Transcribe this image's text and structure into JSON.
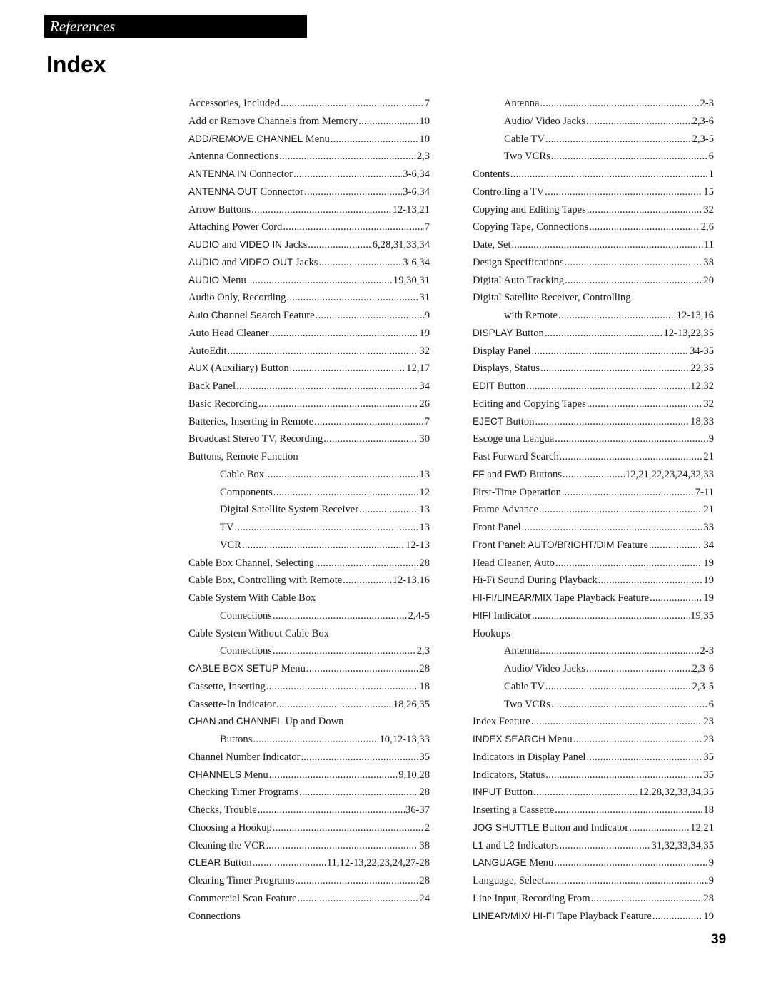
{
  "header": {
    "section": "References",
    "title": "Index"
  },
  "page_number": "39",
  "left_column": [
    {
      "parts": [
        "Accessories, Included"
      ],
      "pages": "7"
    },
    {
      "parts": [
        "Add or Remove Channels from Memory"
      ],
      "pages": "10"
    },
    {
      "parts": [
        {
          "s": "ADD/REMOVE CHANNEL"
        },
        " Menu"
      ],
      "pages": "10"
    },
    {
      "parts": [
        "Antenna Connections"
      ],
      "pages": "2,3"
    },
    {
      "parts": [
        {
          "s": "ANTENNA IN"
        },
        " Connector"
      ],
      "pages": "3-6,34"
    },
    {
      "parts": [
        {
          "s": "ANTENNA OUT"
        },
        " Connector"
      ],
      "pages": "3-6,34"
    },
    {
      "parts": [
        "Arrow Buttons"
      ],
      "pages": "12-13,21"
    },
    {
      "parts": [
        "Attaching Power Cord"
      ],
      "pages": "7"
    },
    {
      "parts": [
        {
          "s": "AUDIO"
        },
        " and ",
        {
          "s": "VIDEO IN"
        },
        " Jacks"
      ],
      "pages": "6,28,31,33,34"
    },
    {
      "parts": [
        {
          "s": "AUDIO"
        },
        " and ",
        {
          "s": "VIDEO OUT"
        },
        " Jacks"
      ],
      "pages": "3-6,34"
    },
    {
      "parts": [
        {
          "s": "AUDIO"
        },
        " Menu"
      ],
      "pages": "19,30,31"
    },
    {
      "parts": [
        "Audio Only, Recording"
      ],
      "pages": "31"
    },
    {
      "parts": [
        {
          "s": "Auto Channel Search"
        },
        " Feature"
      ],
      "pages": "9"
    },
    {
      "parts": [
        "Auto Head Cleaner"
      ],
      "pages": "19"
    },
    {
      "parts": [
        "AutoEdit"
      ],
      "pages": "32"
    },
    {
      "parts": [
        {
          "s": "AUX"
        },
        " (Auxiliary) Button"
      ],
      "pages": "12,17"
    },
    {
      "parts": [
        "Back Panel"
      ],
      "pages": "34"
    },
    {
      "parts": [
        "Basic Recording"
      ],
      "pages": "26"
    },
    {
      "parts": [
        "Batteries, Inserting in Remote"
      ],
      "pages": "7"
    },
    {
      "parts": [
        "Broadcast Stereo TV, Recording"
      ],
      "pages": "30"
    },
    {
      "parts": [
        "Buttons, Remote Function"
      ],
      "pages": "",
      "heading": true
    },
    {
      "parts": [
        "Cable Box"
      ],
      "pages": "13",
      "sub": true
    },
    {
      "parts": [
        "Components"
      ],
      "pages": "12",
      "sub": true
    },
    {
      "parts": [
        "Digital Satellite System Receiver"
      ],
      "pages": "13",
      "sub": true
    },
    {
      "parts": [
        "TV"
      ],
      "pages": "13",
      "sub": true
    },
    {
      "parts": [
        "VCR"
      ],
      "pages": "12-13",
      "sub": true
    },
    {
      "parts": [
        "Cable Box Channel, Selecting"
      ],
      "pages": "28"
    },
    {
      "parts": [
        "Cable Box, Controlling with Remote"
      ],
      "pages": "12-13,16"
    },
    {
      "parts": [
        "Cable System With Cable Box"
      ],
      "pages": "",
      "heading": true
    },
    {
      "parts": [
        "Connections"
      ],
      "pages": "2,4-5",
      "sub": true
    },
    {
      "parts": [
        "Cable System Without Cable Box"
      ],
      "pages": "",
      "heading": true
    },
    {
      "parts": [
        "Connections"
      ],
      "pages": "2,3",
      "sub": true
    },
    {
      "parts": [
        {
          "s": "CABLE BOX SETUP"
        },
        " Menu"
      ],
      "pages": "28"
    },
    {
      "parts": [
        "Cassette, Inserting"
      ],
      "pages": "18"
    },
    {
      "parts": [
        "Cassette-In Indicator"
      ],
      "pages": "18,26,35"
    },
    {
      "parts": [
        {
          "s": "CHAN"
        },
        " and ",
        {
          "s": "CHANNEL"
        },
        " Up and Down"
      ],
      "pages": "",
      "heading": true
    },
    {
      "parts": [
        "Buttons"
      ],
      "pages": "10,12-13,33",
      "sub": true
    },
    {
      "parts": [
        "Channel Number Indicator"
      ],
      "pages": "35"
    },
    {
      "parts": [
        {
          "s": "CHANNELS"
        },
        " Menu"
      ],
      "pages": "9,10,28"
    },
    {
      "parts": [
        "Checking Timer Programs"
      ],
      "pages": "28"
    },
    {
      "parts": [
        "Checks, Trouble"
      ],
      "pages": "36-37"
    },
    {
      "parts": [
        "Choosing a Hookup"
      ],
      "pages": "2"
    },
    {
      "parts": [
        "Cleaning the VCR"
      ],
      "pages": "38"
    },
    {
      "parts": [
        {
          "s": "CLEAR"
        },
        " Button"
      ],
      "pages": "11,12-13,22,23,24,27-28"
    },
    {
      "parts": [
        "Clearing Timer Programs"
      ],
      "pages": "28"
    },
    {
      "parts": [
        "Commercial Scan Feature"
      ],
      "pages": "24"
    },
    {
      "parts": [
        "Connections"
      ],
      "pages": "",
      "heading": true
    }
  ],
  "right_column": [
    {
      "parts": [
        "Antenna"
      ],
      "pages": "2-3",
      "sub": true
    },
    {
      "parts": [
        "Audio/ Video Jacks"
      ],
      "pages": "2,3-6",
      "sub": true
    },
    {
      "parts": [
        "Cable TV"
      ],
      "pages": "2,3-5",
      "sub": true
    },
    {
      "parts": [
        "Two VCRs"
      ],
      "pages": "6",
      "sub": true
    },
    {
      "parts": [
        "Contents"
      ],
      "pages": "1"
    },
    {
      "parts": [
        "Controlling a TV"
      ],
      "pages": "15"
    },
    {
      "parts": [
        "Copying and Editing Tapes"
      ],
      "pages": "32"
    },
    {
      "parts": [
        "Copying Tape, Connections"
      ],
      "pages": "2,6"
    },
    {
      "parts": [
        "Date, Set"
      ],
      "pages": "11"
    },
    {
      "parts": [
        "Design Specifications"
      ],
      "pages": "38"
    },
    {
      "parts": [
        "Digital Auto Tracking"
      ],
      "pages": "20"
    },
    {
      "parts": [
        "Digital Satellite Receiver, Controlling"
      ],
      "pages": "",
      "heading": true
    },
    {
      "parts": [
        "with Remote"
      ],
      "pages": "12-13,16",
      "sub": true
    },
    {
      "parts": [
        {
          "s": "DISPLAY"
        },
        " Button"
      ],
      "pages": "12-13,22,35"
    },
    {
      "parts": [
        "Display Panel"
      ],
      "pages": "34-35"
    },
    {
      "parts": [
        "Displays, Status"
      ],
      "pages": "22,35"
    },
    {
      "parts": [
        {
          "s": "EDIT"
        },
        " Button"
      ],
      "pages": "12,32"
    },
    {
      "parts": [
        "Editing and Copying Tapes"
      ],
      "pages": "32"
    },
    {
      "parts": [
        {
          "s": "EJECT"
        },
        " Button"
      ],
      "pages": "18,33"
    },
    {
      "parts": [
        "Escoge una Lengua"
      ],
      "pages": "9"
    },
    {
      "parts": [
        "Fast Forward Search"
      ],
      "pages": "21"
    },
    {
      "parts": [
        {
          "s": "FF"
        },
        " and ",
        {
          "s": "FWD"
        },
        " Buttons"
      ],
      "pages": "12,21,22,23,24,32,33"
    },
    {
      "parts": [
        "First-Time Operation"
      ],
      "pages": "7-11"
    },
    {
      "parts": [
        "Frame Advance"
      ],
      "pages": "21"
    },
    {
      "parts": [
        "Front Panel"
      ],
      "pages": "33"
    },
    {
      "parts": [
        {
          "s": "Front Panel: AUTO/BRIGHT/DIM"
        },
        " Feature"
      ],
      "pages": "34"
    },
    {
      "parts": [
        "Head Cleaner, Auto"
      ],
      "pages": "19"
    },
    {
      "parts": [
        "Hi-Fi Sound During Playback"
      ],
      "pages": "19"
    },
    {
      "parts": [
        {
          "s": "HI-FI/LINEAR/MIX"
        },
        " Tape Playback Feature"
      ],
      "pages": "19"
    },
    {
      "parts": [
        {
          "s": "HIFI"
        },
        " Indicator"
      ],
      "pages": "19,35"
    },
    {
      "parts": [
        "Hookups"
      ],
      "pages": "",
      "heading": true
    },
    {
      "parts": [
        "Antenna"
      ],
      "pages": "2-3",
      "sub": true
    },
    {
      "parts": [
        "Audio/ Video Jacks"
      ],
      "pages": "2,3-6",
      "sub": true
    },
    {
      "parts": [
        "Cable TV"
      ],
      "pages": "2,3-5",
      "sub": true
    },
    {
      "parts": [
        "Two VCRs"
      ],
      "pages": "6",
      "sub": true
    },
    {
      "parts": [
        "Index Feature"
      ],
      "pages": "23"
    },
    {
      "parts": [
        {
          "s": "INDEX SEARCH"
        },
        " Menu"
      ],
      "pages": "23"
    },
    {
      "parts": [
        "Indicators in Display Panel"
      ],
      "pages": "35"
    },
    {
      "parts": [
        "Indicators, Status"
      ],
      "pages": "35"
    },
    {
      "parts": [
        {
          "s": "INPUT"
        },
        " Button"
      ],
      "pages": "12,28,32,33,34,35"
    },
    {
      "parts": [
        "Inserting a Cassette"
      ],
      "pages": "18"
    },
    {
      "parts": [
        {
          "s": "JOG SHUTTLE"
        },
        " Button and Indicator"
      ],
      "pages": "12,21"
    },
    {
      "parts": [
        {
          "s": "L1"
        },
        " and ",
        {
          "s": "L2"
        },
        " Indicators"
      ],
      "pages": "31,32,33,34,35"
    },
    {
      "parts": [
        {
          "s": "LANGUAGE"
        },
        " Menu"
      ],
      "pages": "9"
    },
    {
      "parts": [
        "Language, Select"
      ],
      "pages": "9"
    },
    {
      "parts": [
        "Line Input, Recording From"
      ],
      "pages": "28"
    },
    {
      "parts": [
        {
          "s": "LINEAR/MIX/ HI-FI"
        },
        " Tape Playback Feature"
      ],
      "pages": "19"
    }
  ]
}
